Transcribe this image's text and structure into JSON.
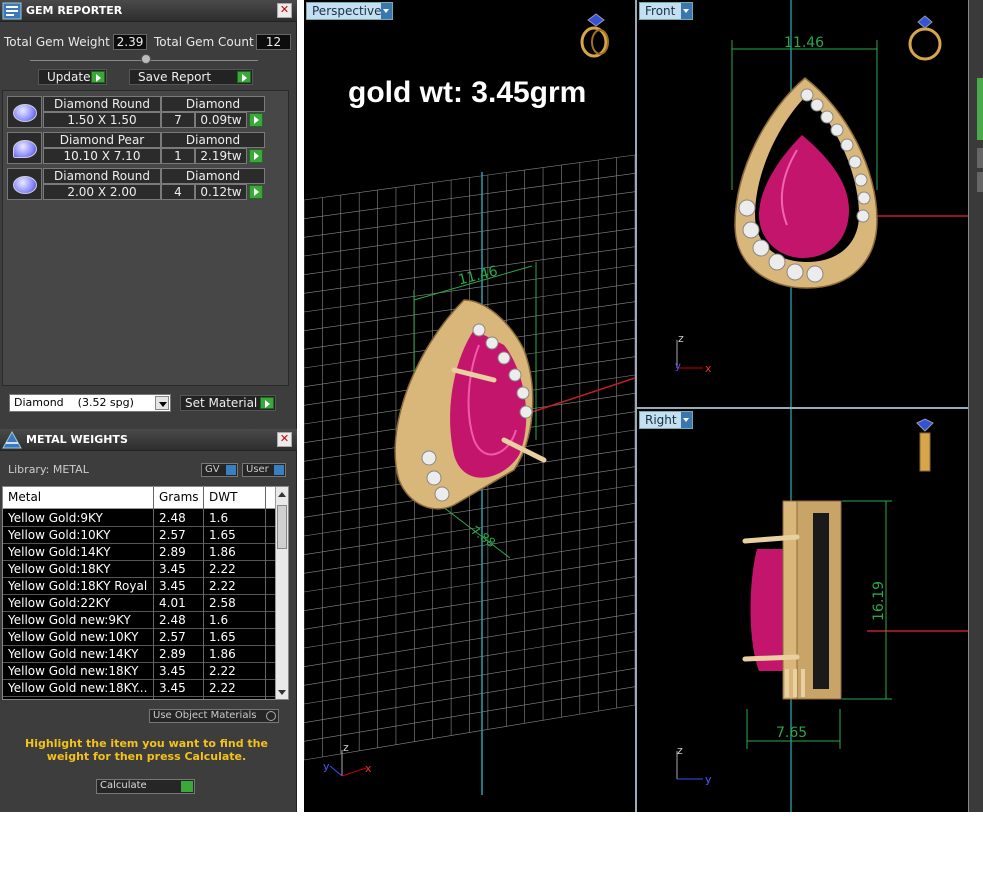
{
  "gem_reporter": {
    "title": "GEM REPORTER",
    "total_gem_weight_label": "Total Gem Weight",
    "total_gem_weight": "2.39",
    "total_gem_count_label": "Total Gem Count",
    "total_gem_count": "12",
    "update_label": "Update",
    "save_report_label": "Save Report",
    "gems": [
      {
        "shape": "Diamond Round",
        "material": "Diamond",
        "size": "1.50 X 1.50",
        "count": "7",
        "weight": "0.09tw"
      },
      {
        "shape": "Diamond Pear",
        "material": "Diamond",
        "size": "10.10 X 7.10",
        "count": "1",
        "weight": "2.19tw"
      },
      {
        "shape": "Diamond Round",
        "material": "Diamond",
        "size": "2.00 X 2.00",
        "count": "4",
        "weight": "0.12tw"
      }
    ],
    "material_select": "Diamond    (3.52 spg)",
    "set_material_label": "Set Material"
  },
  "metal_weights": {
    "title": "METAL WEIGHTS",
    "library_label": "Library: METAL",
    "gv_label": "GV",
    "user_label": "User",
    "columns": [
      "Metal",
      "Grams",
      "DWT"
    ],
    "rows": [
      {
        "metal": "Yellow Gold:9KY",
        "grams": "2.48",
        "dwt": "1.6"
      },
      {
        "metal": "Yellow Gold:10KY",
        "grams": "2.57",
        "dwt": "1.65"
      },
      {
        "metal": "Yellow Gold:14KY",
        "grams": "2.89",
        "dwt": "1.86"
      },
      {
        "metal": "Yellow Gold:18KY",
        "grams": "3.45",
        "dwt": "2.22"
      },
      {
        "metal": "Yellow Gold:18KY Royal",
        "grams": "3.45",
        "dwt": "2.22"
      },
      {
        "metal": "Yellow Gold:22KY",
        "grams": "4.01",
        "dwt": "2.58"
      },
      {
        "metal": "Yellow Gold new:9KY",
        "grams": "2.48",
        "dwt": "1.6"
      },
      {
        "metal": "Yellow Gold new:10KY",
        "grams": "2.57",
        "dwt": "1.65"
      },
      {
        "metal": "Yellow Gold new:14KY",
        "grams": "2.89",
        "dwt": "1.86"
      },
      {
        "metal": "Yellow Gold new:18KY",
        "grams": "3.45",
        "dwt": "2.22"
      },
      {
        "metal": "Yellow Gold new:18KY...",
        "grams": "3.45",
        "dwt": "2.22"
      }
    ],
    "use_object_materials_label": "Use Object Materials",
    "hint": "Highlight the item you want to find the weight for then press Calculate.",
    "calculate_label": "Calculate"
  },
  "viewports": {
    "perspective": {
      "label": "Perspective",
      "overlay_text": "gold wt: 3.45grm",
      "dim_top": "11.46",
      "dim_side": "7.88"
    },
    "front": {
      "label": "Front",
      "dim_top": "11.46"
    },
    "right": {
      "label": "Right",
      "dim_height": "16.19",
      "dim_width": "7.65"
    },
    "axes": {
      "x": "x",
      "y": "y",
      "z": "z"
    }
  },
  "colors": {
    "panel_bg": "#3d3d3d",
    "gold": "#e2c48f",
    "ruby": "#d0197a",
    "dimension": "#2aa84a",
    "hint_text": "#f4c21a",
    "tab_bg": "#c6dff0"
  }
}
